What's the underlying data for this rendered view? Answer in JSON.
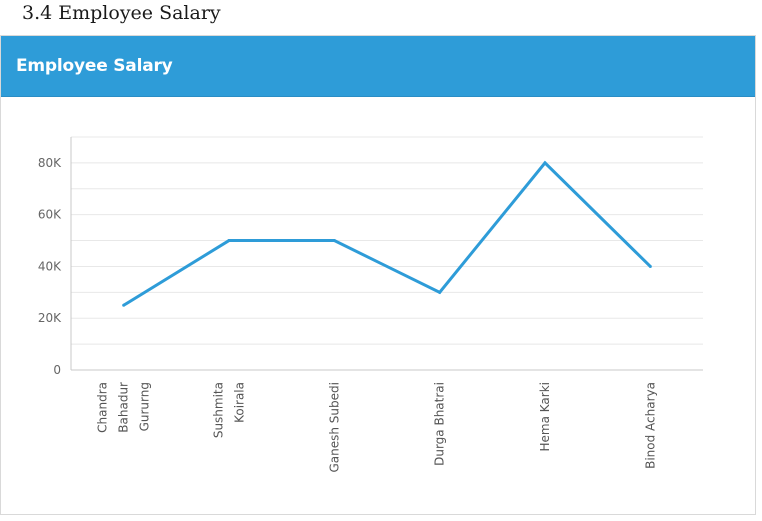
{
  "section": {
    "heading": "3.4 Employee Salary"
  },
  "card": {
    "title": "Employee Salary"
  },
  "chart_data": {
    "type": "line",
    "title": "Employee Salary",
    "xlabel": "",
    "ylabel": "",
    "categories": [
      [
        "Chandra",
        "Bahadur",
        "Gururng"
      ],
      [
        "Sushmita",
        "Koirala"
      ],
      [
        "Ganesh Subedi"
      ],
      [
        "Durga Bhatrai"
      ],
      [
        "Hema Karki"
      ],
      [
        "Binod Acharya"
      ]
    ],
    "values": [
      25000,
      50000,
      50000,
      30000,
      80000,
      40000
    ],
    "ylim": [
      0,
      90000
    ],
    "yticks": [
      0,
      20000,
      40000,
      60000,
      80000
    ],
    "ytick_labels": [
      "0",
      "20K",
      "40K",
      "60K",
      "80K"
    ],
    "grid": true,
    "line_color": "#2e9cd8",
    "grid_color": "#e8e8e8"
  }
}
